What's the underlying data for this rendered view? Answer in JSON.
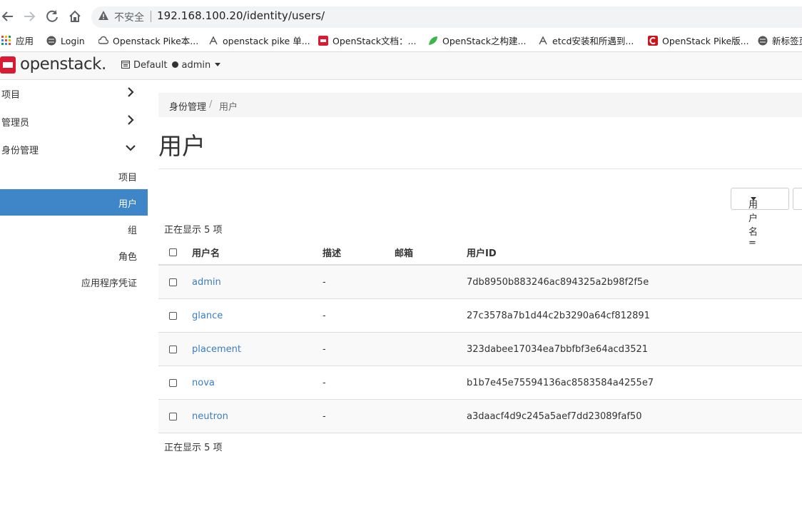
{
  "browser": {
    "insecure_label": "不安全",
    "url": "192.168.100.20/identity/users/"
  },
  "bookmarks": [
    {
      "label": "应用",
      "color": "#e04c3c"
    },
    {
      "label": "Login",
      "color": "#555555"
    },
    {
      "label": "Openstack Pike本...",
      "color": "#555555"
    },
    {
      "label": "openstack pike 单...",
      "color": "#555555"
    },
    {
      "label": "OpenStack文档：...",
      "color": "#da1a32"
    },
    {
      "label": "OpenStack之构建...",
      "color": "#3cb54a"
    },
    {
      "label": "etcd安装和所遇到...",
      "color": "#555555"
    },
    {
      "label": "OpenStack Pike版...",
      "color": "#c9151e"
    },
    {
      "label": "新标签页",
      "color": "#555555"
    }
  ],
  "header": {
    "logo": "openstack.",
    "domain": "Default",
    "project": "admin",
    "brand_color": "#da1a32"
  },
  "sidebar": {
    "items": [
      {
        "label": "项目"
      },
      {
        "label": "管理员"
      },
      {
        "label": "身份管理"
      }
    ],
    "sub_items": [
      {
        "label": "项目"
      },
      {
        "label": "用户"
      },
      {
        "label": "组"
      },
      {
        "label": "角色"
      },
      {
        "label": "应用程序凭证"
      }
    ],
    "active_color": "#3e86c8"
  },
  "main": {
    "breadcrumb": [
      "身份管理",
      "用户"
    ],
    "breadcrumb_sep": "/",
    "title": "用户",
    "filter_label": "用户名=",
    "count_text": "正在显示 5 项",
    "table": {
      "headers": [
        "用户名",
        "描述",
        "邮箱",
        "用户ID"
      ],
      "rows": [
        {
          "name": "admin",
          "description": "-",
          "email": "",
          "id": "7db8950b883246ac894325a2b98f2f5e"
        },
        {
          "name": "glance",
          "description": "-",
          "email": "",
          "id": "27c3578a7b1d44c2b3290a64cf812891"
        },
        {
          "name": "placement",
          "description": "-",
          "email": "",
          "id": "323dabee17034ea7bbfbf3e64acd3521"
        },
        {
          "name": "nova",
          "description": "-",
          "email": "",
          "id": "b1b7e45e75594136ac8583584a4255e7"
        },
        {
          "name": "neutron",
          "description": "-",
          "email": "",
          "id": "a3daacf4d9c245a5aef7dd23089faf50"
        }
      ]
    }
  }
}
